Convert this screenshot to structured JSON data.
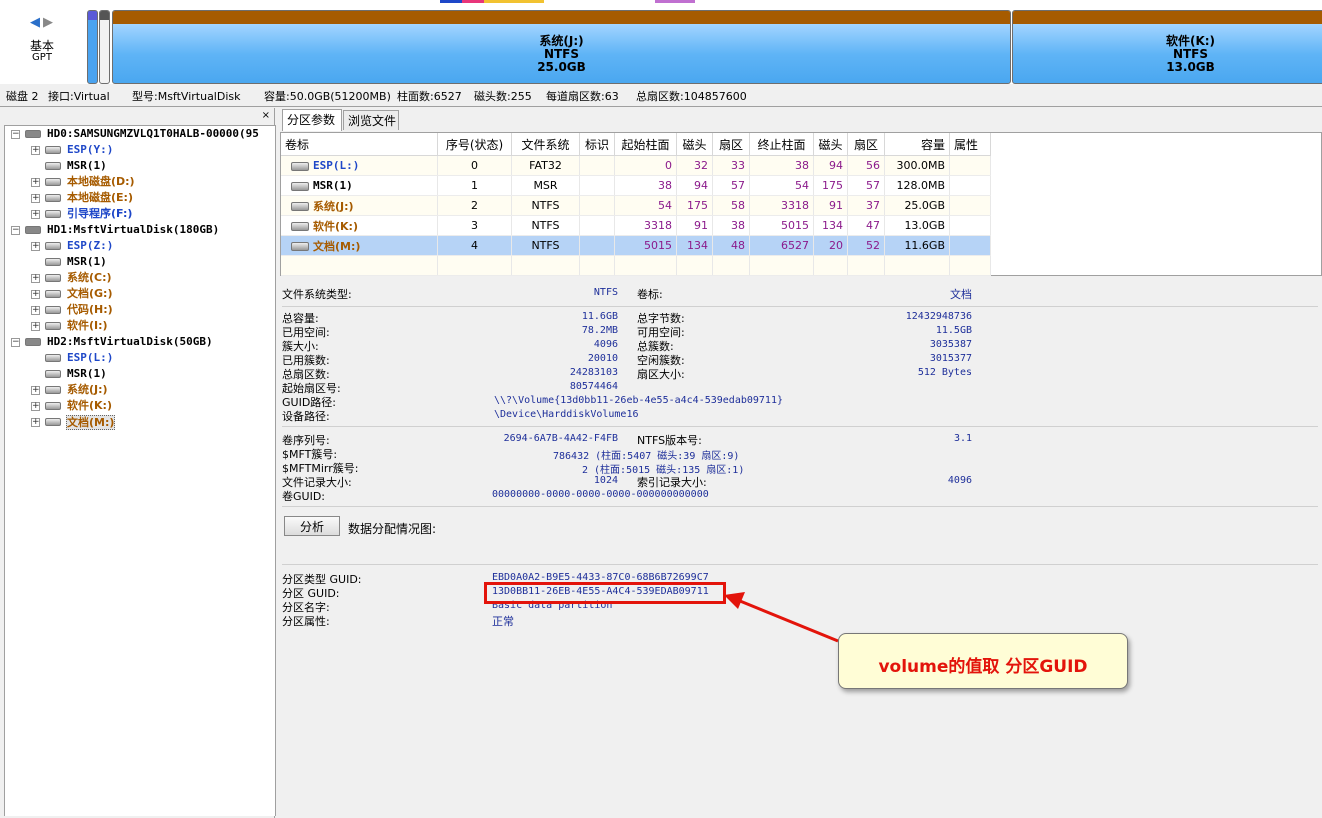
{
  "colors": {
    "accent_blue": "#1e47c8",
    "partition_brown": "#a65b00",
    "selection": "#b6d3f6",
    "highlight_red": "#e3140b"
  },
  "disk_map": {
    "nav_icons": [
      "chevron-left-icon",
      "chevron-right-icon"
    ],
    "disk_type": "基本",
    "partition_style": "GPT",
    "partitions": [
      {
        "name": "系统(J:)",
        "fs": "NTFS",
        "size": "25.0GB"
      },
      {
        "name": "软件(K:)",
        "fs": "NTFS",
        "size": "13.0GB"
      }
    ]
  },
  "disk_info": {
    "disk": "磁盘 2",
    "interface": "接口:Virtual",
    "model": "型号:MsftVirtualDisk",
    "capacity": "容量:50.0GB(51200MB)",
    "cylinders": "柱面数:6527",
    "heads": "磁头数:255",
    "sectors_per_track": "每道扇区数:63",
    "total_sectors": "总扇区数:104857600"
  },
  "tree": {
    "close_label": "×",
    "nodes": [
      {
        "label": "HD0:SAMSUNGMZVLQ1T0HALB-00000(95",
        "color": "black"
      },
      {
        "label": "ESP(Y:)",
        "color": "blue"
      },
      {
        "label": "MSR(1)",
        "color": "black"
      },
      {
        "label": "本地磁盘(D:)",
        "color": "brown"
      },
      {
        "label": "本地磁盘(E:)",
        "color": "brown"
      },
      {
        "label": "引导程序(F:)",
        "color": "blue"
      },
      {
        "label": "HD1:MsftVirtualDisk(180GB)",
        "color": "black"
      },
      {
        "label": "ESP(Z:)",
        "color": "blue"
      },
      {
        "label": "MSR(1)",
        "color": "black"
      },
      {
        "label": "系统(C:)",
        "color": "brown"
      },
      {
        "label": "文档(G:)",
        "color": "brown"
      },
      {
        "label": "代码(H:)",
        "color": "brown"
      },
      {
        "label": "软件(I:)",
        "color": "brown"
      },
      {
        "label": "HD2:MsftVirtualDisk(50GB)",
        "color": "black"
      },
      {
        "label": "ESP(L:)",
        "color": "blue"
      },
      {
        "label": "MSR(1)",
        "color": "black"
      },
      {
        "label": "系统(J:)",
        "color": "brown"
      },
      {
        "label": "软件(K:)",
        "color": "brown"
      },
      {
        "label": "文档(M:)",
        "color": "brown"
      }
    ]
  },
  "tabs": [
    {
      "label": "分区参数"
    },
    {
      "label": "浏览文件"
    }
  ],
  "table": {
    "headers": [
      "卷标",
      "序号(状态)",
      "文件系统",
      "标识",
      "起始柱面",
      "磁头",
      "扇区",
      "终止柱面",
      "磁头",
      "扇区",
      "容量",
      "属性"
    ],
    "rows": [
      [
        "ESP(L:)",
        "0",
        "FAT32",
        "",
        "0",
        "32",
        "33",
        "38",
        "94",
        "56",
        "300.0MB",
        ""
      ],
      [
        "MSR(1)",
        "1",
        "MSR",
        "",
        "38",
        "94",
        "57",
        "54",
        "175",
        "57",
        "128.0MB",
        ""
      ],
      [
        "系统(J:)",
        "2",
        "NTFS",
        "",
        "54",
        "175",
        "58",
        "3318",
        "91",
        "37",
        "25.0GB",
        ""
      ],
      [
        "软件(K:)",
        "3",
        "NTFS",
        "",
        "3318",
        "91",
        "38",
        "5015",
        "134",
        "47",
        "13.0GB",
        ""
      ],
      [
        "文档(M:)",
        "4",
        "NTFS",
        "",
        "5015",
        "134",
        "48",
        "6527",
        "20",
        "52",
        "11.6GB",
        ""
      ]
    ]
  },
  "details": {
    "fs_type_label": "文件系统类型:",
    "fs_type": "NTFS",
    "volume_label_label": "卷标:",
    "volume_label": "文档",
    "total_capacity_label": "总容量:",
    "total_capacity": "11.6GB",
    "total_bytes_label": "总字节数:",
    "total_bytes": "12432948736",
    "used_space_label": "已用空间:",
    "used_space": "78.2MB",
    "free_space_label": "可用空间:",
    "free_space": "11.5GB",
    "cluster_size_label": "簇大小:",
    "cluster_size": "4096",
    "total_clusters_label": "总簇数:",
    "total_clusters": "3035387",
    "used_clusters_label": "已用簇数:",
    "used_clusters": "20010",
    "free_clusters_label": "空闲簇数:",
    "free_clusters": "3015377",
    "total_sectors_label": "总扇区数:",
    "total_sectors": "24283103",
    "sector_size_label": "扇区大小:",
    "sector_size": "512 Bytes",
    "start_sector_label": "起始扇区号:",
    "start_sector": "80574464",
    "guid_path_label": "GUID路径:",
    "guid_path": "\\\\?\\Volume{13d0bb11-26eb-4e55-a4c4-539edab09711}",
    "device_path_label": "设备路径:",
    "device_path": "\\Device\\HarddiskVolume16",
    "serial_label": "卷序列号:",
    "serial": "2694-6A7B-4A42-F4FB",
    "ntfs_version_label": "NTFS版本号:",
    "ntfs_version": "3.1",
    "mft_cluster_label": "$MFT簇号:",
    "mft_cluster": "786432 (柱面:5407 磁头:39 扇区:9)",
    "mftmirr_cluster_label": "$MFTMirr簇号:",
    "mftmirr_cluster": "2 (柱面:5015 磁头:135 扇区:1)",
    "file_record_size_label": "文件记录大小:",
    "file_record_size": "1024",
    "index_record_size_label": "索引记录大小:",
    "index_record_size": "4096",
    "volume_guid_label": "卷GUID:",
    "volume_guid": "00000000-0000-0000-0000-000000000000"
  },
  "analyze": {
    "button_label": "分析",
    "chart_label": "数据分配情况图:"
  },
  "guid_section": {
    "type_guid_label": "分区类型 GUID:",
    "type_guid": "EBD0A0A2-B9E5-4433-87C0-68B6B72699C7",
    "part_guid_label": "分区 GUID:",
    "part_guid": "13D0BB11-26EB-4E55-A4C4-539EDAB09711",
    "name_label": "分区名字:",
    "name": "Basic data partition",
    "attr_label": "分区属性:",
    "attr": "正常"
  },
  "annotation": {
    "text": "volume的值取  分区GUID"
  }
}
